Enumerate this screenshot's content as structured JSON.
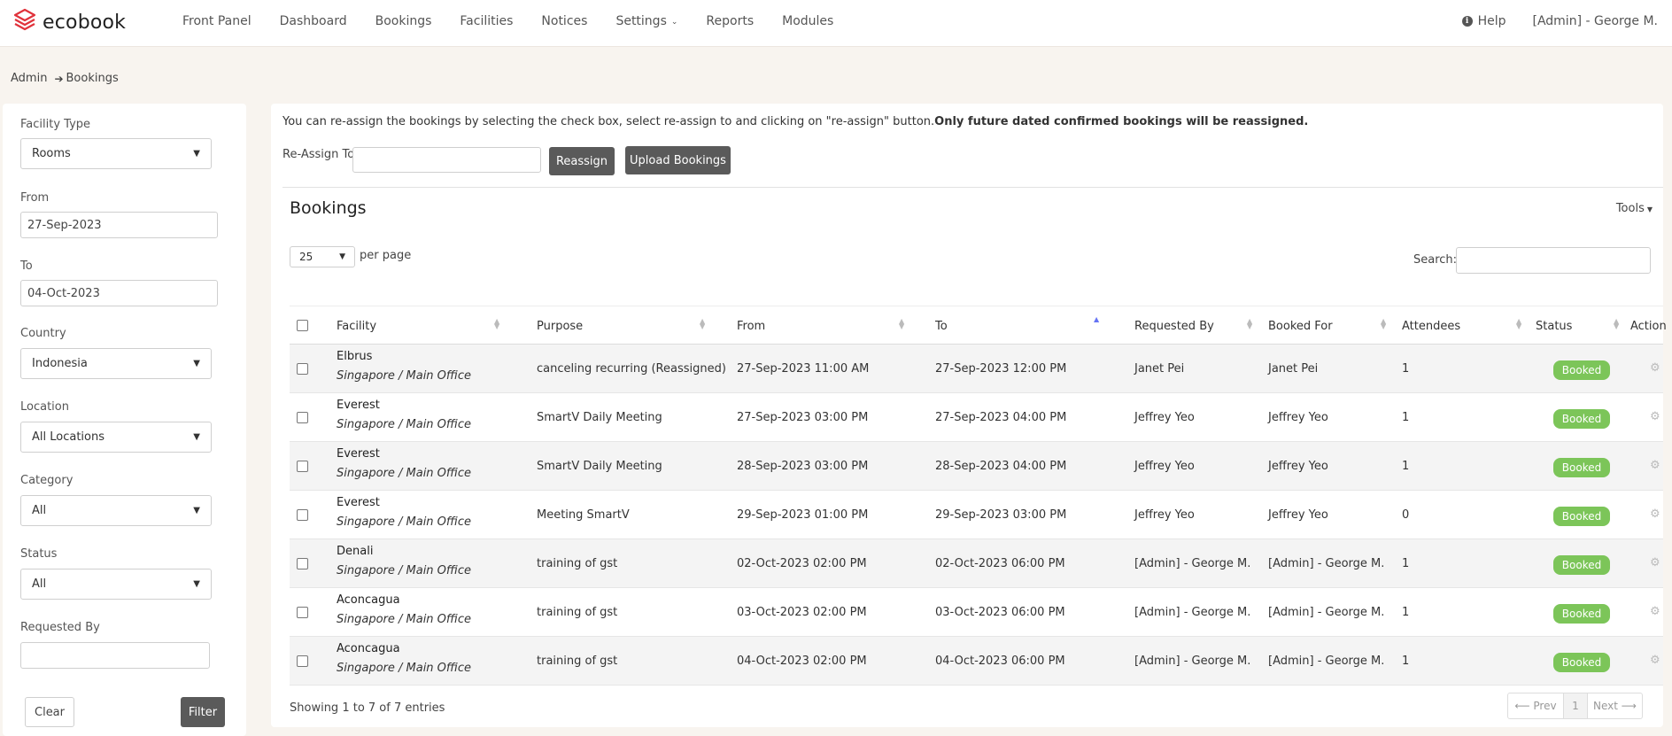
{
  "app": {
    "name": "ecobook"
  },
  "nav": {
    "items": [
      "Front Panel",
      "Dashboard",
      "Bookings",
      "Facilities",
      "Notices",
      "Settings",
      "Reports",
      "Modules"
    ],
    "help": "Help",
    "user": "[Admin] - George M."
  },
  "breadcrumb": {
    "root": "Admin",
    "current": "Bookings"
  },
  "filters": {
    "facility_type": {
      "label": "Facility Type",
      "value": "Rooms"
    },
    "from": {
      "label": "From",
      "value": "27-Sep-2023"
    },
    "to": {
      "label": "To",
      "value": "04-Oct-2023"
    },
    "country": {
      "label": "Country",
      "value": "Indonesia"
    },
    "location": {
      "label": "Location",
      "value": "All Locations"
    },
    "category": {
      "label": "Category",
      "value": "All"
    },
    "status": {
      "label": "Status",
      "value": "All"
    },
    "requested_by": {
      "label": "Requested By",
      "value": ""
    },
    "clear_label": "Clear",
    "filter_label": "Filter"
  },
  "main": {
    "info_text": "You can re-assign the bookings by selecting the check box, select re-assign to and clicking on \"re-assign\" button.",
    "info_bold": "Only future dated confirmed bookings will be reassigned.",
    "reassign_label": "Re-Assign To",
    "reassign_button": "Reassign",
    "upload_button": "Upload Bookings",
    "title": "Bookings",
    "tools": "Tools",
    "per_page_value": "25",
    "per_page_label": "per page",
    "search_label": "Search:"
  },
  "table": {
    "columns": [
      "Facility",
      "Purpose",
      "From",
      "To",
      "Requested By",
      "Booked For",
      "Attendees",
      "Status",
      "Action"
    ],
    "rows": [
      {
        "facility": "Elbrus",
        "location": "Singapore / Main Office",
        "purpose": "canceling recurring (Reassigned)",
        "from": "27-Sep-2023 11:00 AM",
        "to": "27-Sep-2023 12:00 PM",
        "requested_by": "Janet Pei",
        "booked_for": "Janet Pei",
        "attendees": "1",
        "status": "Booked"
      },
      {
        "facility": "Everest",
        "location": "Singapore / Main Office",
        "purpose": "SmartV Daily Meeting",
        "from": "27-Sep-2023 03:00 PM",
        "to": "27-Sep-2023 04:00 PM",
        "requested_by": "Jeffrey Yeo",
        "booked_for": "Jeffrey Yeo",
        "attendees": "1",
        "status": "Booked"
      },
      {
        "facility": "Everest",
        "location": "Singapore / Main Office",
        "purpose": "SmartV Daily Meeting",
        "from": "28-Sep-2023 03:00 PM",
        "to": "28-Sep-2023 04:00 PM",
        "requested_by": "Jeffrey Yeo",
        "booked_for": "Jeffrey Yeo",
        "attendees": "1",
        "status": "Booked"
      },
      {
        "facility": "Everest",
        "location": "Singapore / Main Office",
        "purpose": "Meeting SmartV",
        "from": "29-Sep-2023 01:00 PM",
        "to": "29-Sep-2023 03:00 PM",
        "requested_by": "Jeffrey Yeo",
        "booked_for": "Jeffrey Yeo",
        "attendees": "0",
        "status": "Booked"
      },
      {
        "facility": "Denali",
        "location": "Singapore / Main Office",
        "purpose": "training of gst",
        "from": "02-Oct-2023 02:00 PM",
        "to": "02-Oct-2023 06:00 PM",
        "requested_by": "[Admin] - George M.",
        "booked_for": "[Admin] - George M.",
        "attendees": "1",
        "status": "Booked"
      },
      {
        "facility": "Aconcagua",
        "location": "Singapore / Main Office",
        "purpose": "training of gst",
        "from": "03-Oct-2023 02:00 PM",
        "to": "03-Oct-2023 06:00 PM",
        "requested_by": "[Admin] - George M.",
        "booked_for": "[Admin] - George M.",
        "attendees": "1",
        "status": "Booked"
      },
      {
        "facility": "Aconcagua",
        "location": "Singapore / Main Office",
        "purpose": "training of gst",
        "from": "04-Oct-2023 02:00 PM",
        "to": "04-Oct-2023 06:00 PM",
        "requested_by": "[Admin] - George M.",
        "booked_for": "[Admin] - George M.",
        "attendees": "1",
        "status": "Booked"
      }
    ],
    "showing": "Showing 1 to 7 of 7 entries",
    "pager": {
      "prev": "⟵ Prev",
      "page": "1",
      "next": "Next ⟶"
    }
  },
  "colors": {
    "brand": "#e0323b",
    "booked_badge": "#7cc559",
    "dark_button": "#5a5a5a",
    "background": "#f8f4ef"
  }
}
